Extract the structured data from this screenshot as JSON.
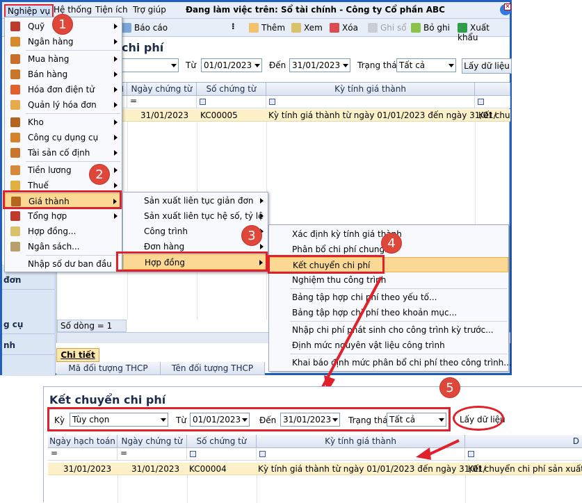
{
  "menubar": {
    "active": "Nghiệp vụ",
    "items": [
      "Hệ thống",
      "Tiện ích",
      "Trợ giúp"
    ],
    "workspace": "Đang làm việc trên: Sổ tài chính - Công ty Cổ phần ABC"
  },
  "toolbar": {
    "report": "Báo cáo",
    "add": "Thêm",
    "view": "Xem",
    "delete": "Xóa",
    "post": "Ghi sổ",
    "unpost": "Bỏ ghi",
    "export": "Xuất khẩu"
  },
  "main": {
    "title": "chi phí",
    "from_label": "Từ",
    "from_value": "01/01/2023",
    "to_label": "Đến",
    "to_value": "31/01/2023",
    "status_label": "Trạng thái",
    "status_value": "Tất cả",
    "fetch_button": "Lấy dữ liệu",
    "columns": [
      "Ngày chứng từ",
      "Số chứng từ",
      "Kỳ tính giá thành"
    ],
    "filter_eq": "=",
    "row": {
      "date": "31/01/2023",
      "no": "KC00005",
      "period": "Kỳ tính giá thành từ ngày 01/01/2023 đến ngày 31/01/",
      "extra": "Kết chuyể"
    },
    "count": "Số dòng = 1",
    "detail_tab": "Chi tiết",
    "detail_cols": [
      "Mã đối tượng THCP",
      "Tên đối tượng THCP"
    ]
  },
  "leftpanel": [
    "đơn",
    "g cụ",
    "nh"
  ],
  "menu1": [
    "Quỹ",
    "Ngân hàng",
    "Mua hàng",
    "Bán hàng",
    "Hóa đơn điện tử",
    "Quản lý hóa đơn",
    "Kho",
    "Công cụ dụng cụ",
    "Tài sản cố định",
    "Tiền lương",
    "Thuế",
    "Giá thành",
    "Tổng hợp",
    "Hợp đồng...",
    "Ngân sách...",
    "Nhập số dư ban đầu"
  ],
  "menu2": [
    "Sản xuất liên tục giản đơn",
    "Sản xuất liên tục hệ số, tỷ lệ",
    "Công trình",
    "Đơn hàng",
    "Hợp đồng"
  ],
  "menu3": [
    "Xác định kỳ tính giá thành",
    "Phân bổ chi phí chung...",
    "Kết chuyển chi phí",
    "Nghiệm thu công trình",
    "Bảng tập hợp chi phí theo yếu tố...",
    "Bảng tập hợp chi phí theo khoản mục...",
    "Nhập chi phí phát sinh cho công trình kỳ trước...",
    "Định mức nguyên vật liệu công trình",
    "Khai báo định mức phân bổ chi phí theo công trình..."
  ],
  "badges": [
    "1",
    "2",
    "3",
    "4",
    "5"
  ],
  "bottom": {
    "title": "Kết chuyển chi phí",
    "period_label": "Kỳ",
    "period_value": "Tùy chọn",
    "from_label": "Từ",
    "from_value": "01/01/2023",
    "to_label": "Đến",
    "to_value": "31/01/2023",
    "status_label": "Trạng thái",
    "status_value": "Tất cả",
    "fetch_button": "Lấy dữ liệu",
    "columns": [
      "Ngày hạch toán",
      "Ngày chứng từ",
      "Số chứng từ",
      "Kỳ tính giá thành",
      "D"
    ],
    "filter_eq": "=",
    "row": {
      "post_date": "31/01/2023",
      "doc_date": "31/01/2023",
      "no": "KC00004",
      "period": "Kỳ tính giá thành từ ngày 01/01/2023 đến ngày 31/01/",
      "desc": "Kết chuyển chi phí sản xuất kỳ"
    }
  },
  "colors": {
    "accent": "#e0202a",
    "highlight": "#fbd995",
    "row": "#fcf1c8",
    "frame": "#1f5fbf"
  }
}
